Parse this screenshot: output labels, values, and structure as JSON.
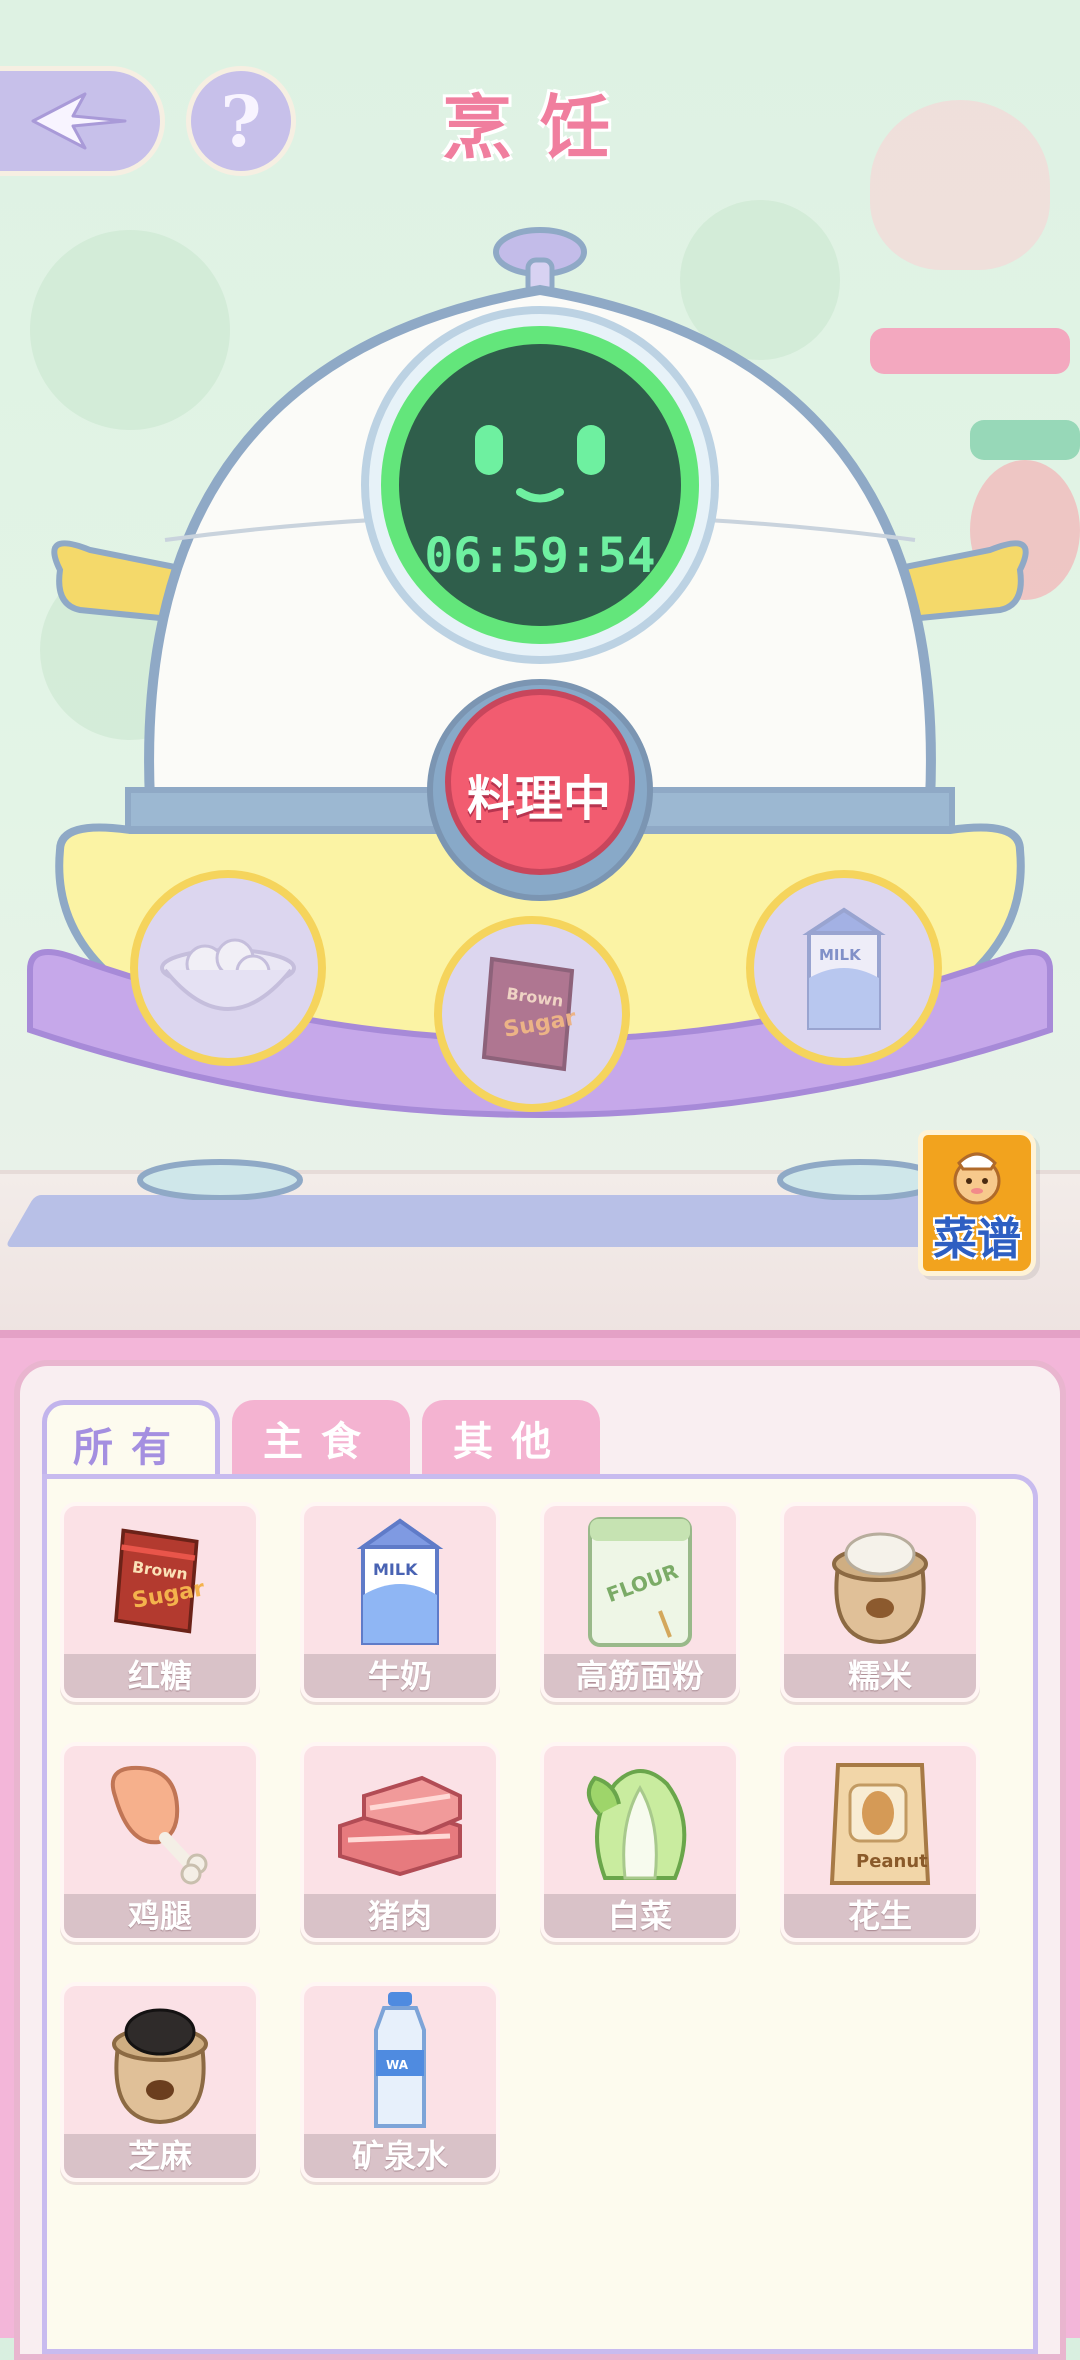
{
  "header": {
    "title": "烹饪",
    "back_icon": "back-arrow-icon",
    "help_label": "?"
  },
  "cooker": {
    "timer": "06:59:54",
    "status_button": "料理中",
    "slots": [
      {
        "item": "糯米",
        "icon": "rice-balls-bowl-icon"
      },
      {
        "item": "红糖",
        "icon": "brown-sugar-icon"
      },
      {
        "item": "牛奶",
        "icon": "milk-carton-icon"
      }
    ]
  },
  "recipe_book": {
    "label": "菜谱"
  },
  "tabs": [
    {
      "label": "所有",
      "active": true
    },
    {
      "label": "主食",
      "active": false
    },
    {
      "label": "其他",
      "active": false
    }
  ],
  "ingredients": [
    {
      "name": "红糖",
      "icon": "brown-sugar-icon"
    },
    {
      "name": "牛奶",
      "icon": "milk-carton-icon"
    },
    {
      "name": "高筋面粉",
      "icon": "flour-bag-icon"
    },
    {
      "name": "糯米",
      "icon": "rice-sack-icon"
    },
    {
      "name": "鸡腿",
      "icon": "chicken-leg-icon"
    },
    {
      "name": "猪肉",
      "icon": "pork-icon"
    },
    {
      "name": "白菜",
      "icon": "cabbage-icon"
    },
    {
      "name": "花生",
      "icon": "peanut-bag-icon"
    },
    {
      "name": "芝麻",
      "icon": "sesame-sack-icon"
    },
    {
      "name": "矿泉水",
      "icon": "water-bottle-icon"
    }
  ],
  "text_on_art": {
    "brown": "Brown",
    "sugar": "Sugar",
    "milk": "MILK",
    "flour": "FLOUR",
    "peanut": "Peanut",
    "water": "WA"
  },
  "colors": {
    "accent_pink": "#f07e9e",
    "tab_purple": "#a48fe0",
    "panel_pink": "#f3b6d9",
    "timer_green": "#6ef0a0",
    "cook_red": "#f25c70"
  }
}
